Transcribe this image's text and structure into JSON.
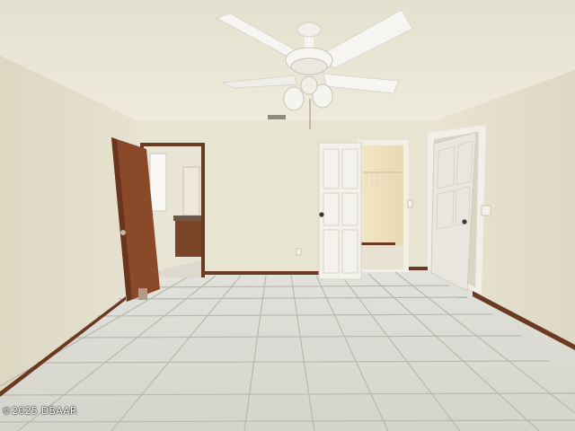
{
  "watermark": {
    "text": "©2025 DBAAR"
  },
  "scene": {
    "type": "photo",
    "colors": {
      "ceiling": "#ebe7d8",
      "wall_left": "#e2deca",
      "wall_back": "#e7e4d1",
      "wall_right": "#e4e0cb",
      "floor_tile": "#d9d9d2",
      "grout": "#b8b6ac",
      "baseboard": "#6b3a22",
      "wood_door": "#8a4a2a",
      "white_door": "#f4f2ec",
      "fan_white": "#f6f5f1"
    }
  }
}
